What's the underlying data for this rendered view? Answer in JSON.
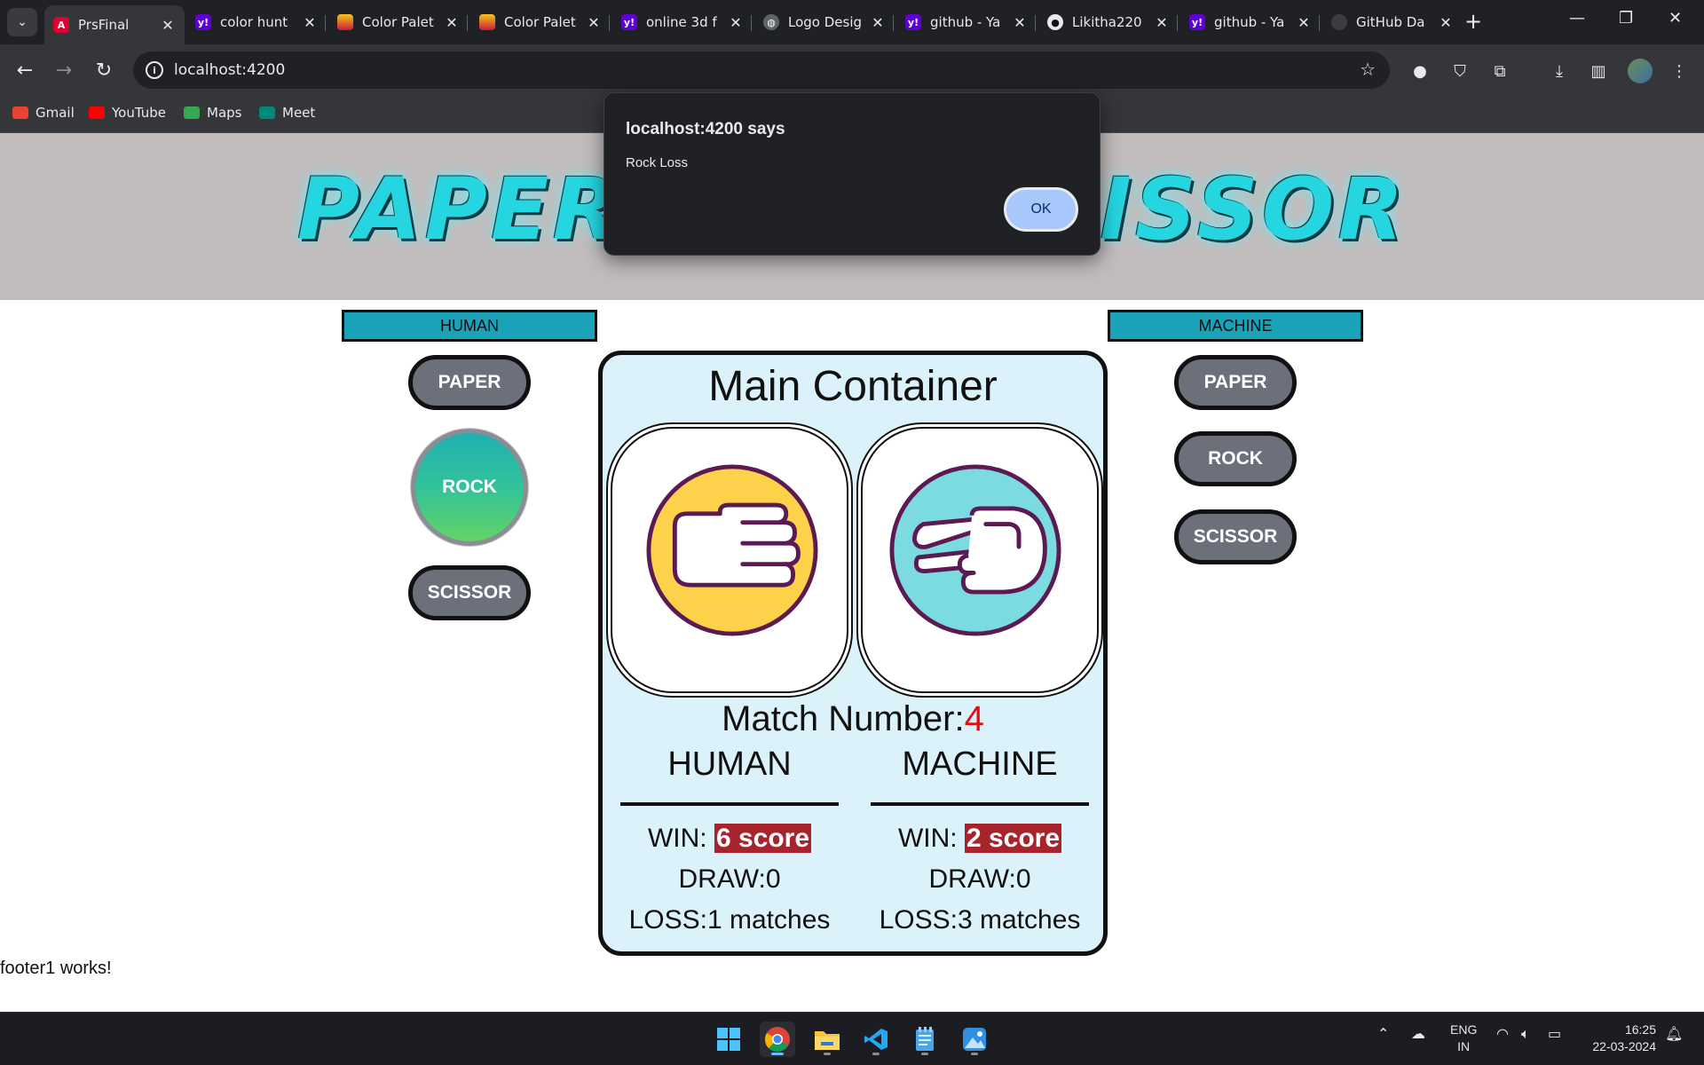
{
  "browser": {
    "tabs": [
      {
        "label": "PrsFinal",
        "icon": "angular-icon",
        "active": true
      },
      {
        "label": "color hunt",
        "icon": "yahoo-icon"
      },
      {
        "label": "Color Palet",
        "icon": "coolors-icon"
      },
      {
        "label": "Color Palet",
        "icon": "coolors-icon"
      },
      {
        "label": "online 3d f",
        "icon": "yahoo-icon"
      },
      {
        "label": "Logo Desig",
        "icon": "globe-icon"
      },
      {
        "label": "github - Ya",
        "icon": "yahoo-icon"
      },
      {
        "label": "Likitha220",
        "icon": "github-icon"
      },
      {
        "label": "github - Ya",
        "icon": "yahoo-icon"
      },
      {
        "label": "GitHub Da",
        "icon": "github-icon"
      }
    ],
    "address": "localhost:4200",
    "bookmarks": [
      {
        "label": "Gmail",
        "color": "#ea4335"
      },
      {
        "label": "YouTube",
        "color": "#ff0000"
      },
      {
        "label": "Maps",
        "color": "#34a853"
      },
      {
        "label": "Meet",
        "color": "#00897b"
      }
    ]
  },
  "page": {
    "banner_title": "PAPER ROCK SCISSOR",
    "human": {
      "title": "HUMAN",
      "choices": [
        "PAPER",
        "ROCK",
        "SCISSOR"
      ],
      "selected": "ROCK"
    },
    "machine": {
      "title": "MACHINE",
      "choices": [
        "PAPER",
        "ROCK",
        "SCISSOR"
      ]
    },
    "main": {
      "title": "Main Container",
      "human_hand": "paper-hand-icon",
      "machine_hand": "scissor-hand-icon",
      "match_label": "Match Number:",
      "match_number": "4",
      "human_score": {
        "name": "HUMAN",
        "win_label": "WIN:",
        "win_value": "6 score",
        "draw": "DRAW:0",
        "loss": "LOSS:1 matches"
      },
      "machine_score": {
        "name": "MACHINE",
        "win_label": "WIN:",
        "win_value": "2 score",
        "draw": "DRAW:0",
        "loss": "LOSS:3 matches"
      }
    },
    "footer": "footer1 works!"
  },
  "dialog": {
    "title": "localhost:4200 says",
    "message": "Rock Loss",
    "ok_label": "OK"
  },
  "taskbar": {
    "lang_line1": "ENG",
    "lang_line2": "IN",
    "time": "16:25",
    "date": "22-03-2024"
  },
  "colors": {
    "accent_cyan": "#1aa3b8",
    "win_badge": "#a8242c",
    "match_number": "#e01010",
    "main_bg": "#dbf2fb"
  }
}
